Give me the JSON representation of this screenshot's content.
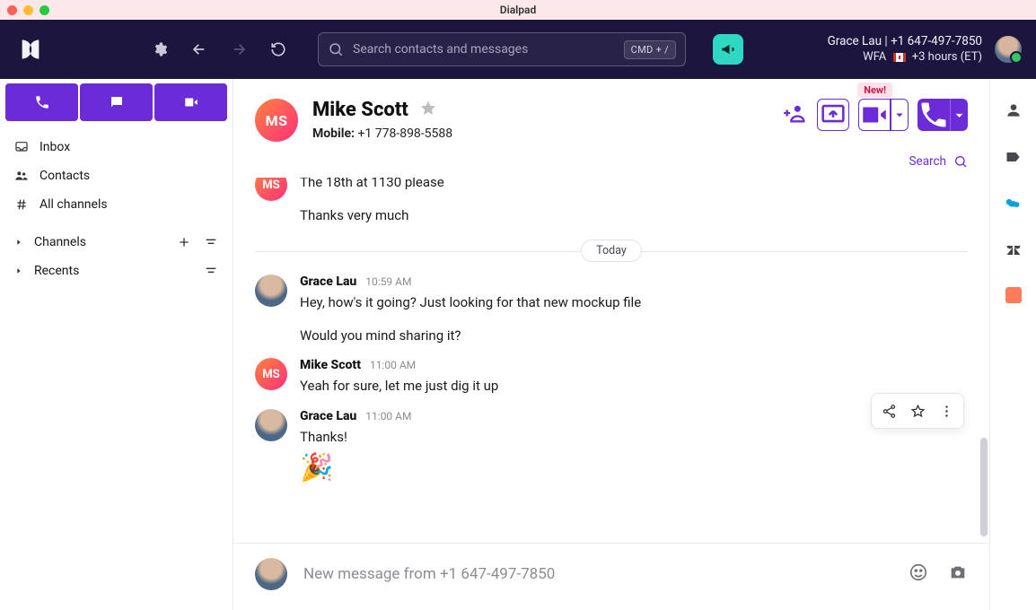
{
  "window": {
    "title": "Dialpad"
  },
  "topnav": {
    "search_placeholder": "Search contacts and messages",
    "shortcut": "CMD + /",
    "user_line1": "Grace Lau | +1 647-497-7850",
    "user_line2_prefix": "WFA",
    "user_line2_suffix": "+3 hours (ET)"
  },
  "contact": {
    "initials": "MS",
    "name": "Mike Scott",
    "phone_label": "Mobile:",
    "phone": "+1 778-898-5588",
    "new_badge": "New!",
    "search_label": "Search"
  },
  "sidebar": {
    "items": [
      {
        "label": "Inbox",
        "icon": "inbox-icon"
      },
      {
        "label": "Contacts",
        "icon": "contacts-icon"
      },
      {
        "label": "All channels",
        "icon": "hash-icon"
      }
    ],
    "sections": [
      {
        "label": "Channels"
      },
      {
        "label": "Recents"
      }
    ]
  },
  "thread": {
    "partial": {
      "lines": [
        "The 18th at 1130 please",
        "Thanks very much"
      ]
    },
    "date_divider": "Today",
    "groups": [
      {
        "author": "Grace Lau",
        "time": "10:59 AM",
        "avatar": "gl",
        "lines": [
          "Hey, how's it going? Just looking for that new mockup file",
          "Would you mind sharing it?"
        ]
      },
      {
        "author": "Mike Scott",
        "time": "11:00 AM",
        "avatar": "ms",
        "lines": [
          "Yeah for sure, let me just dig it up"
        ]
      },
      {
        "author": "Grace Lau",
        "time": "11:00 AM",
        "avatar": "gl",
        "lines": [
          "Thanks!"
        ],
        "reaction": "🎉"
      }
    ]
  },
  "composer": {
    "placeholder": "New message from +1 647-497-7850"
  }
}
